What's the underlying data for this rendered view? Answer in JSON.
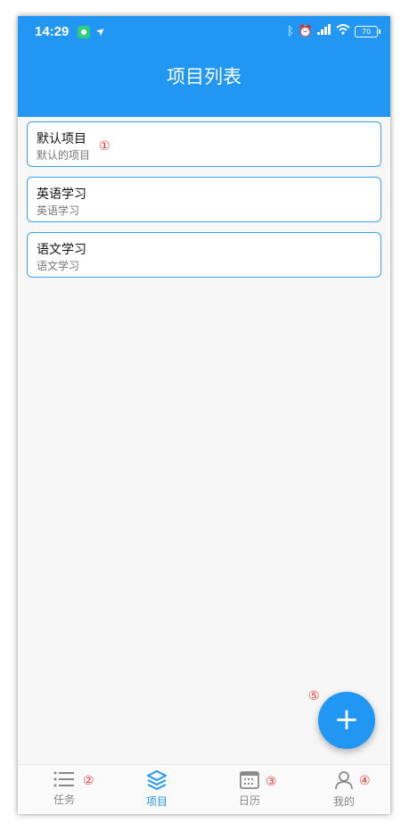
{
  "status": {
    "time": "14:29",
    "battery": "70"
  },
  "header": {
    "title": "项目列表"
  },
  "projects": [
    {
      "name": "默认项目",
      "desc": "默认的项目"
    },
    {
      "name": "英语学习",
      "desc": "英语学习"
    },
    {
      "name": "语文学习",
      "desc": "语文学习"
    }
  ],
  "annotations": {
    "m1": "①",
    "m2": "②",
    "m3": "③",
    "m4": "④",
    "m5": "⑤"
  },
  "fab": {
    "label": "+"
  },
  "nav": [
    {
      "label": "任务",
      "icon": "list-icon"
    },
    {
      "label": "项目",
      "icon": "layers-icon"
    },
    {
      "label": "日历",
      "icon": "calendar-icon"
    },
    {
      "label": "我的",
      "icon": "user-icon"
    }
  ],
  "colors": {
    "primary": "#2196f3",
    "annotation": "#e53935"
  }
}
